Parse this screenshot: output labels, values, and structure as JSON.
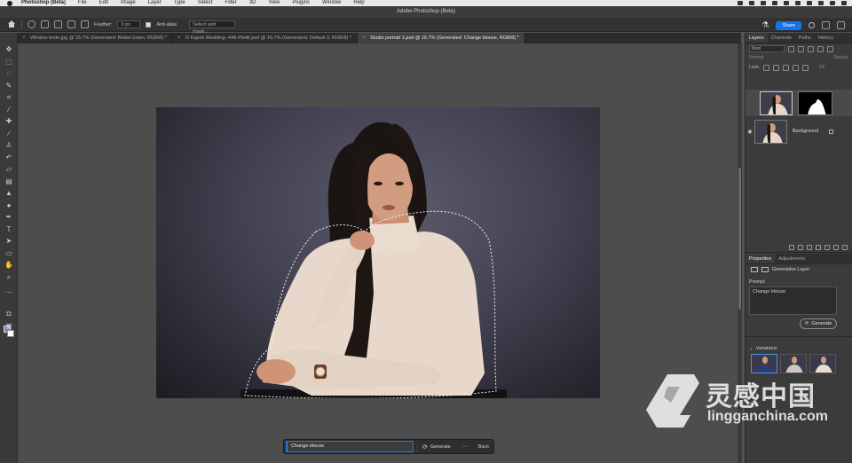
{
  "menubar": {
    "app": "Photoshop (Beta)",
    "items": [
      "File",
      "Edit",
      "Image",
      "Layer",
      "Type",
      "Select",
      "Filter",
      "3D",
      "View",
      "Plugins",
      "Window",
      "Help"
    ]
  },
  "window_title": "Adobe Photoshop (Beta)",
  "options": {
    "feather_label": "Feather:",
    "feather_value": "0 px",
    "antialias_label": "Anti-alias",
    "select_mask": "Select and mask...",
    "share_label": "Share"
  },
  "tabs": [
    {
      "label": "Window bride.jpg @ 15.7% (Generated: Bridal Gown, RGB/8) *"
    },
    {
      "label": "O Kapek Wedding--448-Pledit.psd @ 16.7% (Generated: Default 3, RGB/8) *"
    },
    {
      "label": "Studio portrait 1.psd @ 16.7% (Generated: Change blouse, RGB/8) *"
    }
  ],
  "taskbar": {
    "input_value": "Change blouse",
    "generate_label": "Generate",
    "more_label": "···",
    "back_label": "Back"
  },
  "layers_panel": {
    "tabs": [
      "Layers",
      "Channels",
      "Paths",
      "History"
    ],
    "kind_label": "Kind",
    "blend_mode": "Normal",
    "opacity_label": "Opacity",
    "lock_label": "Lock:",
    "fill_label": "Fill",
    "layers": [
      {
        "name": ""
      },
      {
        "name": "Background"
      }
    ]
  },
  "properties_panel": {
    "tabs": [
      "Properties",
      "Adjustments"
    ],
    "type_label": "Generative Layer",
    "prompt_label": "Prompt",
    "prompt_value": "Change blouse",
    "generate_label": "Generate",
    "variations_label": "Variations"
  },
  "watermark": {
    "title": "灵感中国",
    "subtitle": "lingganchina.com"
  },
  "colors": {
    "accent": "#1473e6",
    "foreground_swatch": "#8a78c2",
    "background_swatch": "#ffffff"
  }
}
